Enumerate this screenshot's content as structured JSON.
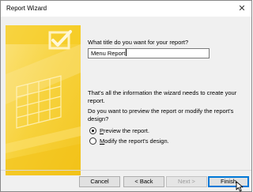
{
  "window": {
    "title": "Report Wizard",
    "close_glyph": "✕"
  },
  "main": {
    "title_question": "What title do you want for your report?",
    "title_value": "Menu Report",
    "info_text": "That's all the information the wizard needs to create your report.",
    "preview_question": "Do you want to preview the report or modify the report's design?",
    "options": [
      {
        "prefix": "",
        "accel": "P",
        "rest": "review the report.",
        "selected": true
      },
      {
        "prefix": "",
        "accel": "M",
        "rest": "odify the report's design.",
        "selected": false
      }
    ]
  },
  "buttons": {
    "cancel": "Cancel",
    "back": "< Back",
    "next": "Next >",
    "finish": "Finish"
  },
  "icons": {
    "wizard_art": "report-wizard-art-icon",
    "cursor": "mouse-pointer-icon"
  },
  "colors": {
    "art_yellow": "#f7d23c",
    "accent_blue": "#0078d7"
  }
}
